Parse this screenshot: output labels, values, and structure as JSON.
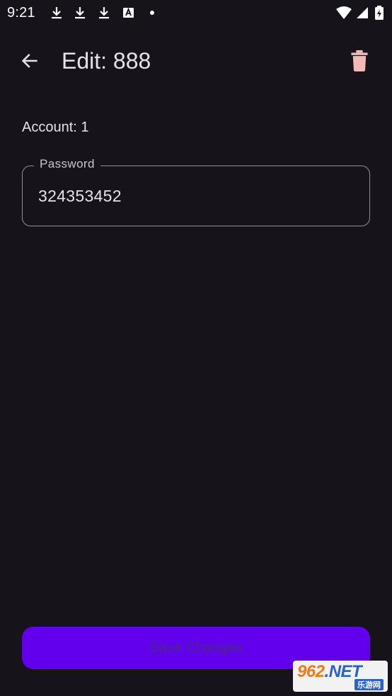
{
  "status_bar": {
    "time": "9:21",
    "left_icons": [
      "download-icon",
      "download-icon",
      "download-icon",
      "a-badge-icon",
      "dot-icon"
    ],
    "right_icons": [
      "wifi-icon",
      "signal-icon",
      "battery-icon"
    ]
  },
  "app_bar": {
    "title": "Edit: 888",
    "back_icon": "arrow-left-icon",
    "delete_icon": "trash-icon",
    "delete_color": "#f2b8b5"
  },
  "content": {
    "account_label": "Account: 1",
    "password_field": {
      "label": "Password",
      "value": "324353452"
    }
  },
  "actions": {
    "save_label": "Save Changes",
    "save_color": "#6200ee"
  },
  "watermark": {
    "brand_number": "962",
    "brand_suffix": ".NET",
    "brand_sub": "乐游网"
  },
  "colors": {
    "background": "#16131b",
    "text": "#e7e1ea",
    "outline": "#958e99"
  }
}
